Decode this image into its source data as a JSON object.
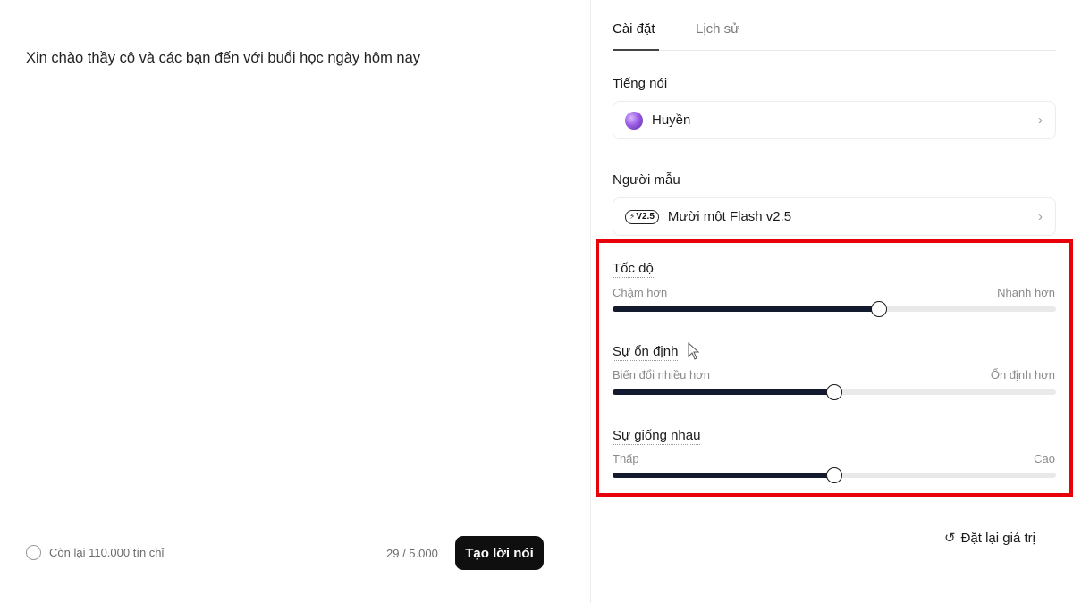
{
  "editor": {
    "text": "Xin chào thầy cô và các bạn đến với buổi học ngày hôm nay",
    "credits_label": "Còn lại 110.000 tín chỉ",
    "char_count": "29 / 5.000",
    "generate_label": "Tạo lời nói"
  },
  "tabs": [
    {
      "label": "Cài đặt",
      "active": true
    },
    {
      "label": "Lịch sử",
      "active": false
    }
  ],
  "voice": {
    "label": "Tiếng nói",
    "value": "Huyền"
  },
  "model": {
    "label": "Người mẫu",
    "badge": "V2.5",
    "value": "Mười một Flash v2.5"
  },
  "sliders": {
    "speed": {
      "title": "Tốc độ",
      "min_label": "Chậm hơn",
      "max_label": "Nhanh hơn",
      "value": 0.6
    },
    "stability": {
      "title": "Sự ổn định",
      "min_label": "Biến đổi nhiều hơn",
      "max_label": "Ổn định hơn",
      "value": 0.5
    },
    "similarity": {
      "title": "Sự giống nhau",
      "min_label": "Thấp",
      "max_label": "Cao",
      "value": 0.5
    }
  },
  "reset_label": "Đặt lại giá trị",
  "colors": {
    "highlight": "#e8000b",
    "slider_fill": "#141a2e",
    "button_bg": "#0f0f0f"
  },
  "icons": {
    "chevron": "chevron-right-icon",
    "reset": "reset-icon",
    "credits": "circle-icon"
  }
}
